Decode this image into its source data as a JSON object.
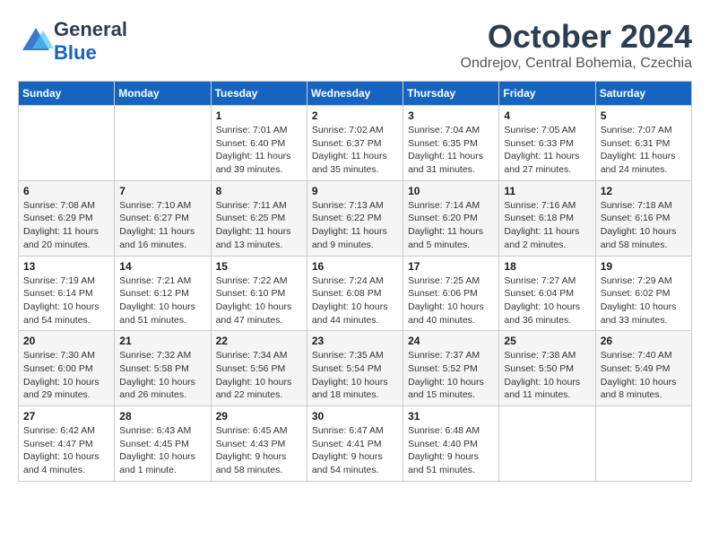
{
  "header": {
    "logo_line1": "General",
    "logo_line2": "Blue",
    "month_year": "October 2024",
    "location": "Ondrejov, Central Bohemia, Czechia"
  },
  "weekdays": [
    "Sunday",
    "Monday",
    "Tuesday",
    "Wednesday",
    "Thursday",
    "Friday",
    "Saturday"
  ],
  "weeks": [
    [
      {
        "day": "",
        "info": ""
      },
      {
        "day": "",
        "info": ""
      },
      {
        "day": "1",
        "info": "Sunrise: 7:01 AM\nSunset: 6:40 PM\nDaylight: 11 hours and 39 minutes."
      },
      {
        "day": "2",
        "info": "Sunrise: 7:02 AM\nSunset: 6:37 PM\nDaylight: 11 hours and 35 minutes."
      },
      {
        "day": "3",
        "info": "Sunrise: 7:04 AM\nSunset: 6:35 PM\nDaylight: 11 hours and 31 minutes."
      },
      {
        "day": "4",
        "info": "Sunrise: 7:05 AM\nSunset: 6:33 PM\nDaylight: 11 hours and 27 minutes."
      },
      {
        "day": "5",
        "info": "Sunrise: 7:07 AM\nSunset: 6:31 PM\nDaylight: 11 hours and 24 minutes."
      }
    ],
    [
      {
        "day": "6",
        "info": "Sunrise: 7:08 AM\nSunset: 6:29 PM\nDaylight: 11 hours and 20 minutes."
      },
      {
        "day": "7",
        "info": "Sunrise: 7:10 AM\nSunset: 6:27 PM\nDaylight: 11 hours and 16 minutes."
      },
      {
        "day": "8",
        "info": "Sunrise: 7:11 AM\nSunset: 6:25 PM\nDaylight: 11 hours and 13 minutes."
      },
      {
        "day": "9",
        "info": "Sunrise: 7:13 AM\nSunset: 6:22 PM\nDaylight: 11 hours and 9 minutes."
      },
      {
        "day": "10",
        "info": "Sunrise: 7:14 AM\nSunset: 6:20 PM\nDaylight: 11 hours and 5 minutes."
      },
      {
        "day": "11",
        "info": "Sunrise: 7:16 AM\nSunset: 6:18 PM\nDaylight: 11 hours and 2 minutes."
      },
      {
        "day": "12",
        "info": "Sunrise: 7:18 AM\nSunset: 6:16 PM\nDaylight: 10 hours and 58 minutes."
      }
    ],
    [
      {
        "day": "13",
        "info": "Sunrise: 7:19 AM\nSunset: 6:14 PM\nDaylight: 10 hours and 54 minutes."
      },
      {
        "day": "14",
        "info": "Sunrise: 7:21 AM\nSunset: 6:12 PM\nDaylight: 10 hours and 51 minutes."
      },
      {
        "day": "15",
        "info": "Sunrise: 7:22 AM\nSunset: 6:10 PM\nDaylight: 10 hours and 47 minutes."
      },
      {
        "day": "16",
        "info": "Sunrise: 7:24 AM\nSunset: 6:08 PM\nDaylight: 10 hours and 44 minutes."
      },
      {
        "day": "17",
        "info": "Sunrise: 7:25 AM\nSunset: 6:06 PM\nDaylight: 10 hours and 40 minutes."
      },
      {
        "day": "18",
        "info": "Sunrise: 7:27 AM\nSunset: 6:04 PM\nDaylight: 10 hours and 36 minutes."
      },
      {
        "day": "19",
        "info": "Sunrise: 7:29 AM\nSunset: 6:02 PM\nDaylight: 10 hours and 33 minutes."
      }
    ],
    [
      {
        "day": "20",
        "info": "Sunrise: 7:30 AM\nSunset: 6:00 PM\nDaylight: 10 hours and 29 minutes."
      },
      {
        "day": "21",
        "info": "Sunrise: 7:32 AM\nSunset: 5:58 PM\nDaylight: 10 hours and 26 minutes."
      },
      {
        "day": "22",
        "info": "Sunrise: 7:34 AM\nSunset: 5:56 PM\nDaylight: 10 hours and 22 minutes."
      },
      {
        "day": "23",
        "info": "Sunrise: 7:35 AM\nSunset: 5:54 PM\nDaylight: 10 hours and 18 minutes."
      },
      {
        "day": "24",
        "info": "Sunrise: 7:37 AM\nSunset: 5:52 PM\nDaylight: 10 hours and 15 minutes."
      },
      {
        "day": "25",
        "info": "Sunrise: 7:38 AM\nSunset: 5:50 PM\nDaylight: 10 hours and 11 minutes."
      },
      {
        "day": "26",
        "info": "Sunrise: 7:40 AM\nSunset: 5:49 PM\nDaylight: 10 hours and 8 minutes."
      }
    ],
    [
      {
        "day": "27",
        "info": "Sunrise: 6:42 AM\nSunset: 4:47 PM\nDaylight: 10 hours and 4 minutes."
      },
      {
        "day": "28",
        "info": "Sunrise: 6:43 AM\nSunset: 4:45 PM\nDaylight: 10 hours and 1 minute."
      },
      {
        "day": "29",
        "info": "Sunrise: 6:45 AM\nSunset: 4:43 PM\nDaylight: 9 hours and 58 minutes."
      },
      {
        "day": "30",
        "info": "Sunrise: 6:47 AM\nSunset: 4:41 PM\nDaylight: 9 hours and 54 minutes."
      },
      {
        "day": "31",
        "info": "Sunrise: 6:48 AM\nSunset: 4:40 PM\nDaylight: 9 hours and 51 minutes."
      },
      {
        "day": "",
        "info": ""
      },
      {
        "day": "",
        "info": ""
      }
    ]
  ]
}
